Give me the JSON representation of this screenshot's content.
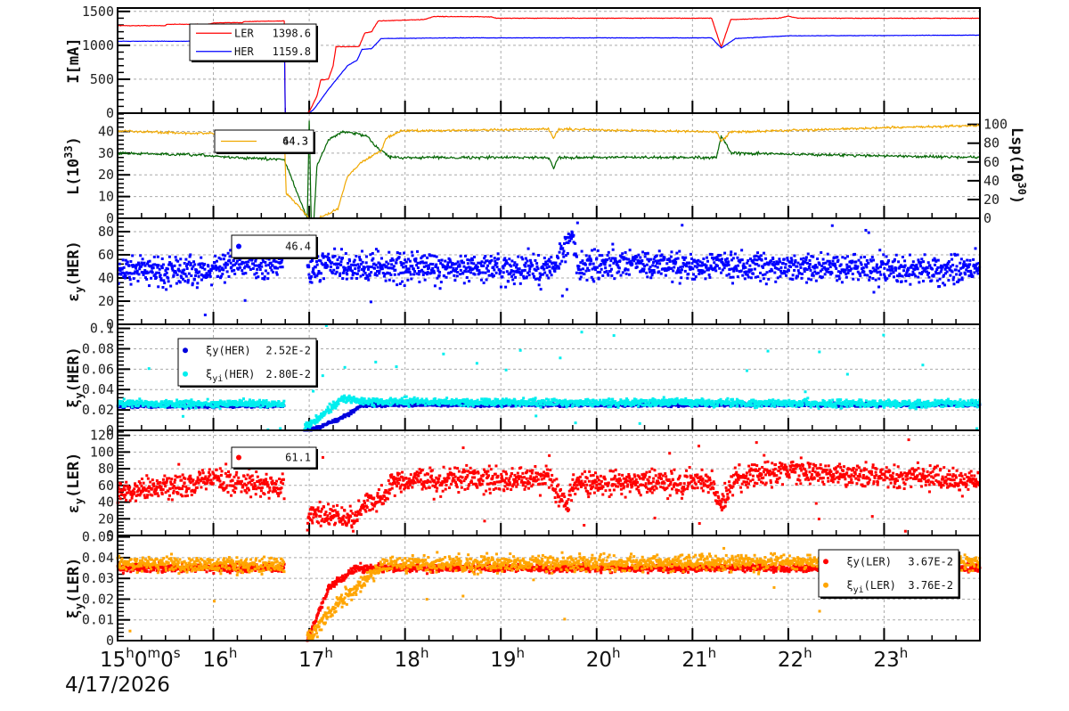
{
  "chart_data": {
    "type": "line+scatter",
    "x_axis": {
      "range": [
        15,
        24
      ],
      "ticks": [
        15,
        16,
        17,
        18,
        19,
        20,
        21,
        22,
        23
      ],
      "tick_labels": [
        "15h0m0s",
        "16h",
        "17h",
        "18h",
        "19h",
        "20h",
        "21h",
        "22h",
        "23h"
      ],
      "date": "4/17/2026",
      "grid": true
    },
    "panels": [
      {
        "ylabel": [
          "I[mA]"
        ],
        "ylim": [
          0,
          1550
        ],
        "yticks": [
          0,
          500,
          1000,
          1500
        ],
        "ytick_labels": [
          "0",
          "500",
          "1000",
          "1500"
        ],
        "legend": [
          {
            "label": "LER",
            "value": "1398.6",
            "series": 0
          },
          {
            "label": "HER",
            "value": "1159.8",
            "series": 1
          }
        ],
        "series": [
          {
            "name": "LER",
            "type": "line",
            "color": "#ff0000",
            "noise": 4,
            "points": [
              [
                15,
                1290
              ],
              [
                15.5,
                1290
              ],
              [
                15.51,
                1310
              ],
              [
                15.95,
                1310
              ],
              [
                16.0,
                1330
              ],
              [
                16.3,
                1335
              ],
              [
                16.32,
                1350
              ],
              [
                16.74,
                1360
              ],
              [
                16.75,
                0
              ],
              [
                16.97,
                0
              ],
              [
                17.0,
                20
              ],
              [
                17.08,
                250
              ],
              [
                17.12,
                490
              ],
              [
                17.2,
                500
              ],
              [
                17.25,
                700
              ],
              [
                17.28,
                980
              ],
              [
                17.52,
                980
              ],
              [
                17.58,
                1180
              ],
              [
                17.65,
                1200
              ],
              [
                17.72,
                1360
              ],
              [
                18.2,
                1380
              ],
              [
                18.3,
                1425
              ],
              [
                18.9,
                1420
              ],
              [
                18.95,
                1400
              ],
              [
                21.2,
                1400
              ],
              [
                21.3,
                970
              ],
              [
                21.4,
                1380
              ],
              [
                21.9,
                1400
              ],
              [
                22.0,
                1430
              ],
              [
                22.1,
                1400
              ],
              [
                24,
                1398.6
              ]
            ]
          },
          {
            "name": "HER",
            "type": "line",
            "color": "#0000ff",
            "noise": 3,
            "points": [
              [
                15,
                1060
              ],
              [
                15.9,
                1060
              ],
              [
                16.0,
                1100
              ],
              [
                16.74,
                1100
              ],
              [
                16.75,
                0
              ],
              [
                17.0,
                0
              ],
              [
                17.05,
                60
              ],
              [
                17.2,
                350
              ],
              [
                17.4,
                700
              ],
              [
                17.5,
                780
              ],
              [
                17.55,
                940
              ],
              [
                17.65,
                950
              ],
              [
                17.75,
                1100
              ],
              [
                18.5,
                1110
              ],
              [
                21.2,
                1110
              ],
              [
                21.3,
                960
              ],
              [
                21.45,
                1100
              ],
              [
                22.0,
                1140
              ],
              [
                24,
                1150
              ]
            ]
          }
        ]
      },
      {
        "ylabel": [
          "L(10",
          "33",
          ")"
        ],
        "ylim": [
          0,
          48.4
        ],
        "yticks": [
          0,
          10,
          20,
          30,
          40
        ],
        "ytick_labels": [
          "0",
          "10",
          "20",
          "30",
          "40"
        ],
        "ylabel_right": [
          "Lsp(10",
          "30",
          ")"
        ],
        "ylim_right": [
          0,
          112
        ],
        "yticks_right": [
          0,
          20,
          40,
          60,
          80,
          100
        ],
        "ytick_labels_right": [
          "0",
          "20",
          "40",
          "60",
          "80",
          "100"
        ],
        "legend": [
          {
            "label": "",
            "value": "44.3",
            "value_overlap": "64.3",
            "series": 1
          }
        ],
        "series": [
          {
            "name": "L",
            "type": "line",
            "color": "#006400",
            "noise": 0.6,
            "points": [
              [
                15,
                30
              ],
              [
                15.9,
                29
              ],
              [
                16.2,
                28
              ],
              [
                16.74,
                27
              ],
              [
                16.98,
                0
              ],
              [
                17.0,
                45
              ],
              [
                17.02,
                0
              ],
              [
                17.05,
                0
              ],
              [
                17.08,
                24
              ],
              [
                17.2,
                36
              ],
              [
                17.35,
                40
              ],
              [
                17.6,
                38
              ],
              [
                17.7,
                33
              ],
              [
                17.85,
                28
              ],
              [
                19.5,
                28
              ],
              [
                19.55,
                23
              ],
              [
                19.6,
                28
              ],
              [
                21.25,
                28
              ],
              [
                21.3,
                38
              ],
              [
                21.4,
                30
              ],
              [
                24,
                28
              ]
            ]
          },
          {
            "name": "Lsp",
            "type": "line",
            "axis": "right",
            "color": "#f0a800",
            "noise": 1.2,
            "points": [
              [
                15,
                93
              ],
              [
                16,
                90
              ],
              [
                16.74,
                92
              ],
              [
                16.76,
                27
              ],
              [
                17.0,
                0
              ],
              [
                17.1,
                0
              ],
              [
                17.3,
                10
              ],
              [
                17.4,
                45
              ],
              [
                17.55,
                60
              ],
              [
                17.75,
                72
              ],
              [
                17.8,
                85
              ],
              [
                17.95,
                93
              ],
              [
                19.5,
                95
              ],
              [
                19.55,
                85
              ],
              [
                19.6,
                95
              ],
              [
                21.25,
                92
              ],
              [
                21.3,
                82
              ],
              [
                21.4,
                92
              ],
              [
                24,
                99
              ]
            ]
          }
        ]
      },
      {
        "ylabel": [
          "ε",
          "y",
          "(HER)"
        ],
        "ylim": [
          0,
          91.5
        ],
        "yticks": [
          0,
          20,
          40,
          60,
          80
        ],
        "ytick_labels": [
          "0",
          "20",
          "40",
          "60",
          "80"
        ],
        "legend": [
          {
            "label": "",
            "value": "46.4",
            "series": 0
          }
        ],
        "series": [
          {
            "name": "εy(HER)",
            "type": "scatter",
            "color": "#0000ff",
            "noise": 6,
            "outlier_rate": 0.01,
            "points": [
              [
                15,
                47
              ],
              [
                15.9,
                45
              ],
              [
                16.2,
                52
              ],
              [
                16.74,
                52
              ],
              null,
              [
                16.98,
                42
              ],
              [
                17.2,
                52
              ],
              [
                17.5,
                50
              ],
              [
                19.5,
                48
              ],
              [
                19.75,
                75
              ],
              [
                19.8,
                50
              ],
              [
                20.2,
                52
              ],
              [
                24,
                47
              ]
            ]
          }
        ]
      },
      {
        "ylabel": [
          "ξ",
          "y",
          "(HER)"
        ],
        "ylim": [
          0,
          0.104
        ],
        "yticks": [
          0,
          0.02,
          0.04,
          0.06,
          0.08,
          0.1
        ],
        "ytick_labels": [
          "0",
          "0.02",
          "0.04",
          "0.06",
          "0.08",
          "0.1"
        ],
        "legend": [
          {
            "label": "ξy(HER)",
            "sub": "y",
            "base": "ξ",
            "rest": "(HER)",
            "value": "2.52E-2",
            "series": 0
          },
          {
            "label": "ξyi(HER)",
            "sub": "yi",
            "base": "ξ",
            "rest": "(HER)",
            "value": "2.80E-2",
            "series": 1
          }
        ],
        "series": [
          {
            "name": "ξy(HER)",
            "type": "scatter",
            "color": "#0000dd",
            "noise": 0.0008,
            "outlier_rate": 0,
            "points": [
              [
                15,
                0.024
              ],
              [
                16.74,
                0.024
              ],
              null,
              [
                16.95,
                0
              ],
              [
                17.1,
                0.003
              ],
              [
                17.4,
                0.015
              ],
              [
                17.55,
                0.025
              ],
              [
                24,
                0.025
              ]
            ]
          },
          {
            "name": "ξyi(HER)",
            "type": "scatter",
            "color": "#00eeee",
            "noise": 0.0018,
            "outlier_rate": 0.012,
            "points": [
              [
                15,
                0.026
              ],
              [
                16.74,
                0.026
              ],
              null,
              [
                16.95,
                0.002
              ],
              [
                17.2,
                0.02
              ],
              [
                17.35,
                0.032
              ],
              [
                17.6,
                0.028
              ],
              [
                24,
                0.026
              ]
            ]
          }
        ]
      },
      {
        "ylabel": [
          "ε",
          "y",
          "(LER)"
        ],
        "ylim": [
          0,
          126
        ],
        "yticks": [
          0,
          20,
          40,
          60,
          80,
          100,
          120
        ],
        "ytick_labels": [
          "0",
          "20",
          "40",
          "60",
          "80",
          "100",
          "120"
        ],
        "legend": [
          {
            "label": "",
            "value": "61.1",
            "series": 0
          }
        ],
        "series": [
          {
            "name": "εy(LER)",
            "type": "scatter",
            "color": "#ff0000",
            "noise": 7,
            "outlier_rate": 0.015,
            "points": [
              [
                15,
                52
              ],
              [
                15.8,
                60
              ],
              [
                16.0,
                75
              ],
              [
                16.1,
                65
              ],
              [
                16.74,
                60
              ],
              null,
              [
                16.98,
                10
              ],
              [
                17.0,
                25
              ],
              [
                17.5,
                22
              ],
              [
                17.6,
                40
              ],
              [
                17.8,
                45
              ],
              [
                17.85,
                65
              ],
              [
                19.5,
                68
              ],
              [
                19.7,
                35
              ],
              [
                19.75,
                62
              ],
              [
                21.2,
                65
              ],
              [
                21.3,
                35
              ],
              [
                21.45,
                70
              ],
              [
                22,
                78
              ],
              [
                24,
                65
              ]
            ]
          }
        ]
      },
      {
        "ylabel": [
          "ξ",
          "y",
          "(LER)"
        ],
        "ylim": [
          0,
          0.0507
        ],
        "yticks": [
          0,
          0.01,
          0.02,
          0.03,
          0.04,
          0.05
        ],
        "ytick_labels": [
          "0",
          "0.01",
          "0.02",
          "0.03",
          "0.04",
          "0.05"
        ],
        "legend": [
          {
            "label": "ξy(LER)",
            "sub": "y",
            "base": "ξ",
            "rest": "(LER)",
            "value": "3.67E-2",
            "series": 0
          },
          {
            "label": "ξyi(LER)",
            "sub": "yi",
            "base": "ξ",
            "rest": "(LER)",
            "value": "3.76E-2",
            "series": 1
          }
        ],
        "series": [
          {
            "name": "ξy(LER)",
            "type": "scatter",
            "color": "#ff0000",
            "noise": 0.0009,
            "outlier_rate": 0,
            "points": [
              [
                15,
                0.035
              ],
              [
                16.74,
                0.035
              ],
              null,
              [
                16.98,
                0
              ],
              [
                17.2,
                0.025
              ],
              [
                17.5,
                0.035
              ],
              [
                24,
                0.035
              ]
            ]
          },
          {
            "name": "ξyi(LER)",
            "type": "scatter",
            "color": "#ffa500",
            "noise": 0.0018,
            "outlier_rate": 0.01,
            "points": [
              [
                15,
                0.037
              ],
              [
                16.74,
                0.036
              ],
              null,
              [
                16.98,
                0
              ],
              [
                17.3,
                0.018
              ],
              [
                17.8,
                0.037
              ],
              [
                24,
                0.038
              ]
            ]
          }
        ]
      }
    ]
  }
}
